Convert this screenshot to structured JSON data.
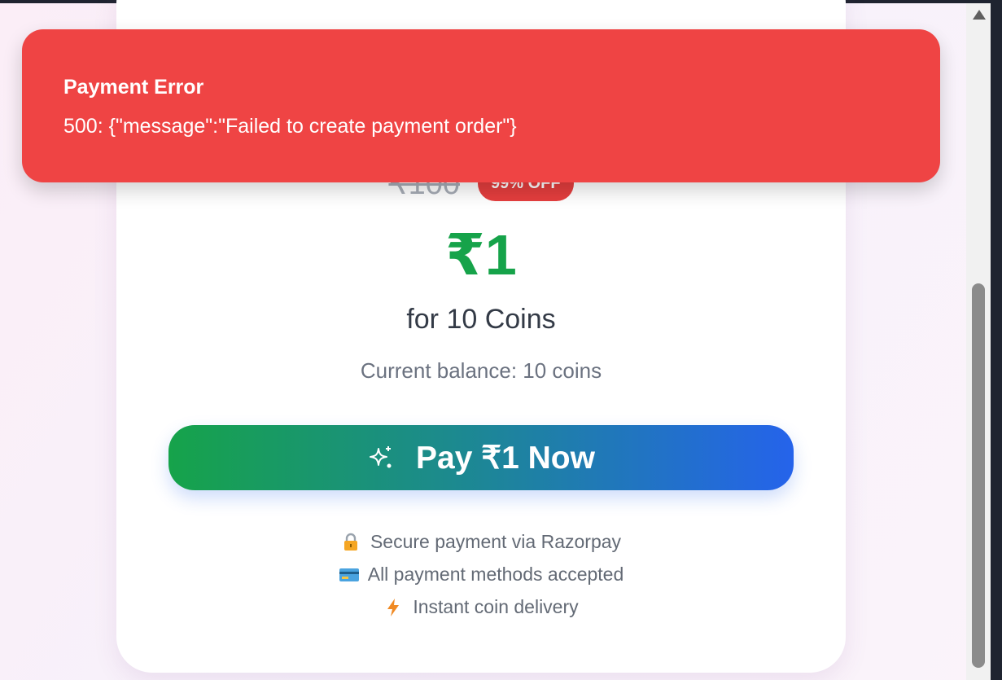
{
  "toast": {
    "title": "Payment Error",
    "message": "500: {\"message\":\"Failed to create payment order\"}",
    "color": "#ef4444"
  },
  "offer": {
    "original_price": "₹100",
    "discount_badge": "99% OFF",
    "price": "₹1",
    "coins_text": "for 10 Coins",
    "balance_text": "Current balance: 10 coins",
    "price_color": "#16a34a"
  },
  "pay_button": {
    "label": "Pay ₹1 Now",
    "icon": "sparkles-icon"
  },
  "features": [
    {
      "icon": "lock-icon",
      "text": "Secure payment via Razorpay"
    },
    {
      "icon": "credit-card-icon",
      "text": "All payment methods accepted"
    },
    {
      "icon": "lightning-icon",
      "text": "Instant coin delivery"
    }
  ]
}
